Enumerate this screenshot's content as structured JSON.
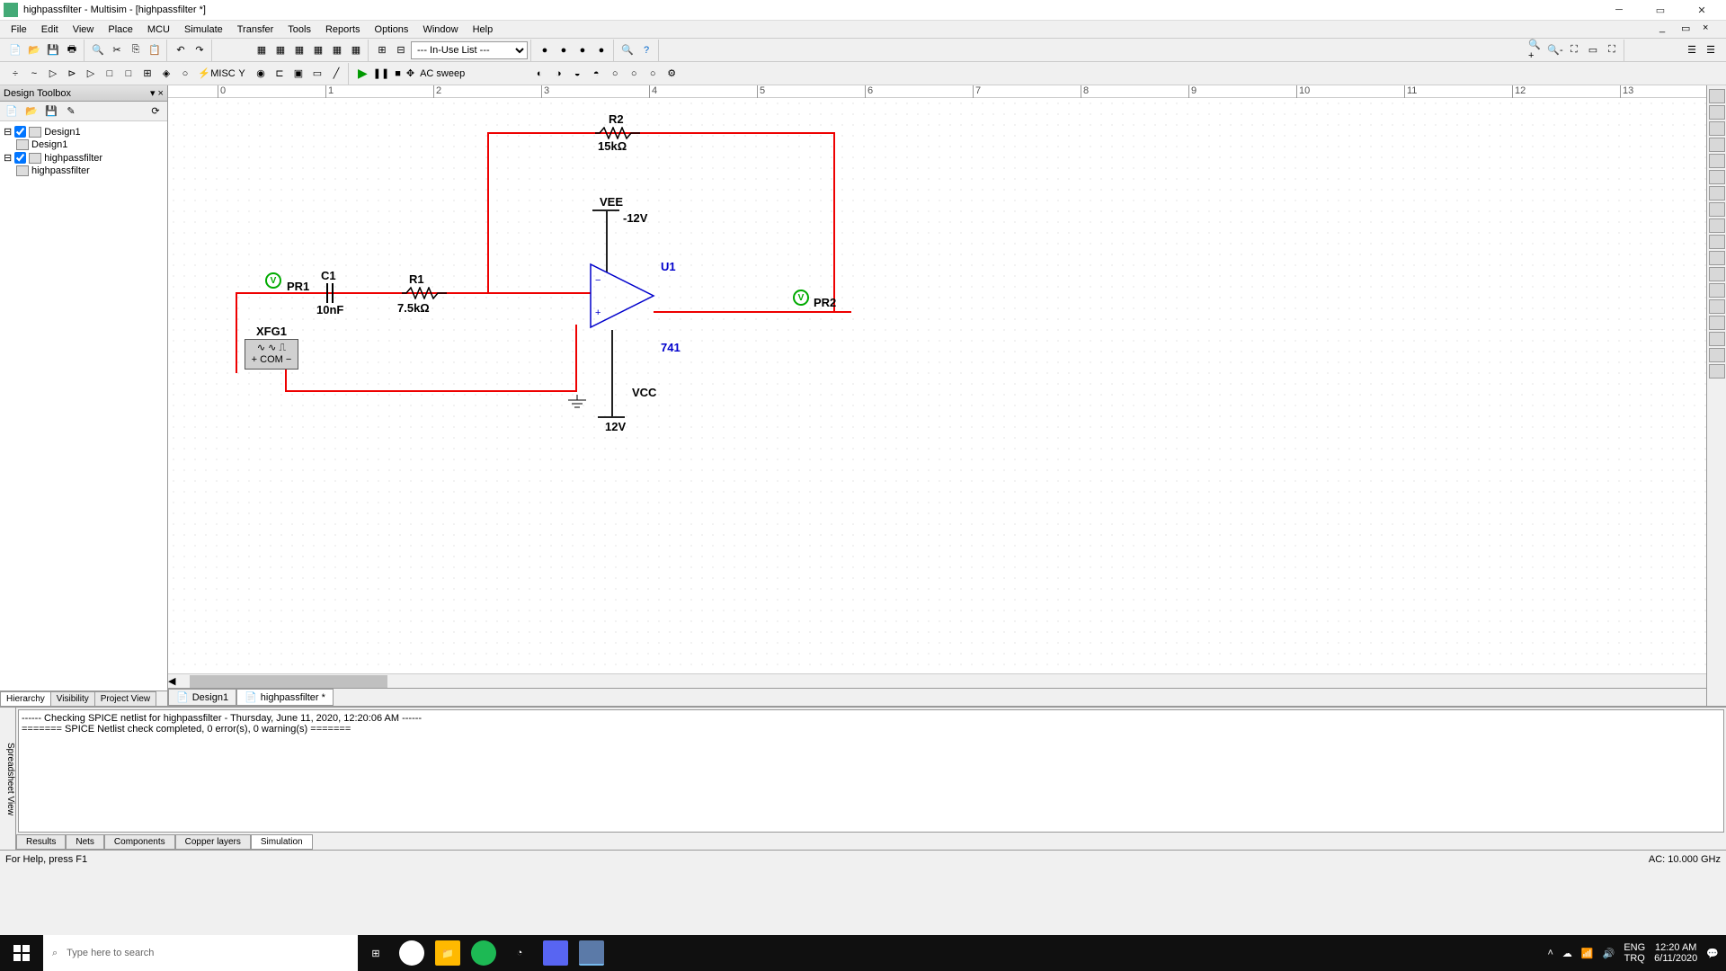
{
  "title": "highpassfilter - Multisim - [highpassfilter *]",
  "menu": [
    "File",
    "Edit",
    "View",
    "Place",
    "MCU",
    "Simulate",
    "Transfer",
    "Tools",
    "Reports",
    "Options",
    "Window",
    "Help"
  ],
  "combo1": "--- In-Use List ---",
  "sim_mode": "AC sweep",
  "sidebar": {
    "title": "Design Toolbox",
    "tree": [
      {
        "lvl": 0,
        "label": "Design1"
      },
      {
        "lvl": 1,
        "label": "Design1"
      },
      {
        "lvl": 0,
        "label": "highpassfilter"
      },
      {
        "lvl": 1,
        "label": "highpassfilter"
      }
    ],
    "tabs": [
      "Hierarchy",
      "Visibility",
      "Project View"
    ]
  },
  "ruler": [
    "0",
    "1",
    "2",
    "3",
    "4",
    "5",
    "6",
    "7",
    "8",
    "9",
    "10",
    "11",
    "12",
    "13"
  ],
  "components": {
    "R2_name": "R2",
    "R2_val": "15kΩ",
    "VEE_name": "VEE",
    "VEE_val": "-12V",
    "C1_name": "C1",
    "C1_val": "10nF",
    "R1_name": "R1",
    "R1_val": "7.5kΩ",
    "U1_name": "U1",
    "U1_val": "741",
    "VCC_name": "VCC",
    "VCC_val": "12V",
    "PR1": "PR1",
    "PR2": "PR2",
    "XFG1": "XFG1",
    "XFG1_com": "COM"
  },
  "doctabs": [
    "Design1",
    "highpassfilter *"
  ],
  "bottom": {
    "side": "Spreadsheet View",
    "lines": [
      "------ Checking SPICE netlist for highpassfilter - Thursday, June 11, 2020, 12:20:06 AM ------",
      "======= SPICE Netlist check completed, 0 error(s), 0 warning(s) ======="
    ],
    "tabs": [
      "Results",
      "Nets",
      "Components",
      "Copper layers",
      "Simulation"
    ]
  },
  "status": {
    "left": "For Help, press F1",
    "right": "AC: 10.000 GHz"
  },
  "taskbar": {
    "search_placeholder": "Type here to search",
    "lang1": "ENG",
    "lang2": "TRQ",
    "time": "12:20 AM",
    "date": "6/11/2020"
  }
}
